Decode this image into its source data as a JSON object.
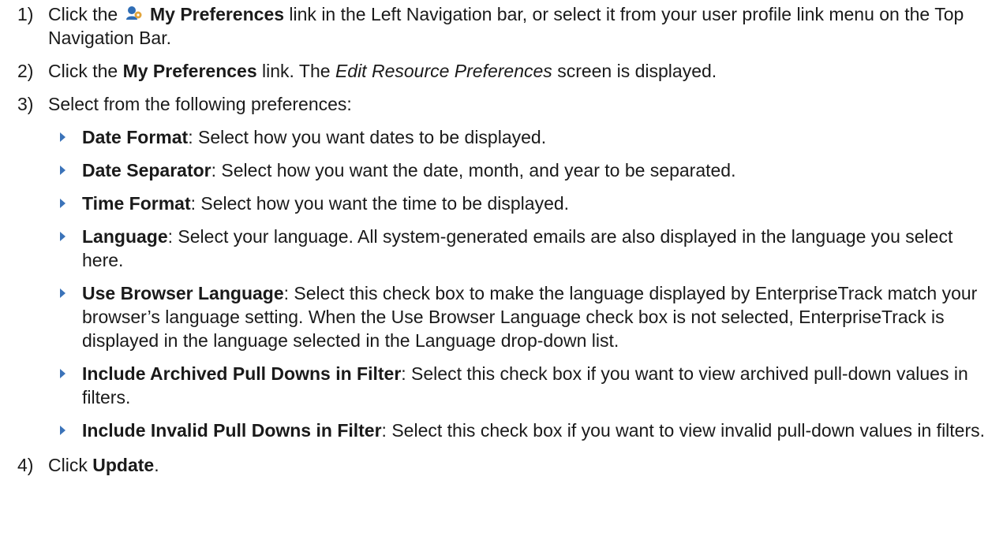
{
  "steps": [
    {
      "num": "1)",
      "pre": "Click the",
      "icon": "preferences-icon",
      "bold": "My Preferences",
      "post": "link in the Left Navigation bar, or select it from your user profile link menu on the Top Navigation Bar."
    },
    {
      "num": "2)",
      "pre": "Click the",
      "bold": "My Preferences",
      "mid": "link. The",
      "italic": "Edit Resource Preferences",
      "post": "screen is displayed."
    },
    {
      "num": "3)",
      "text": "Select from the following preferences:"
    },
    {
      "num": "4)",
      "pre": "Click",
      "bold": "Update",
      "post": "."
    }
  ],
  "preferences": [
    {
      "term": "Date Format",
      "desc": ": Select how you want dates to be displayed."
    },
    {
      "term": "Date Separator",
      "desc": ": Select how you want the date, month, and year to be separated."
    },
    {
      "term": "Time Format",
      "desc": ": Select how you want the time to be displayed."
    },
    {
      "term": "Language",
      "desc": ": Select your language. All system-generated emails are also displayed in the language you select here."
    },
    {
      "term": "Use Browser Language",
      "desc": ": Select this check box to make the language displayed by EnterpriseTrack match your browser’s language setting. When the Use Browser Language check box is not selected, EnterpriseTrack is displayed in the language selected in the Language drop-down list."
    },
    {
      "term": "Include Archived Pull Downs in Filter",
      "desc": ": Select this check box if you want to view archived pull-down values in filters."
    },
    {
      "term": "Include Invalid Pull Downs in Filter",
      "desc": ": Select this check box if you want to view invalid pull-down values in filters."
    }
  ],
  "colors": {
    "bullet": "#3b73b9",
    "icon_primary": "#2f6db5",
    "icon_accent": "#e2a43a"
  }
}
